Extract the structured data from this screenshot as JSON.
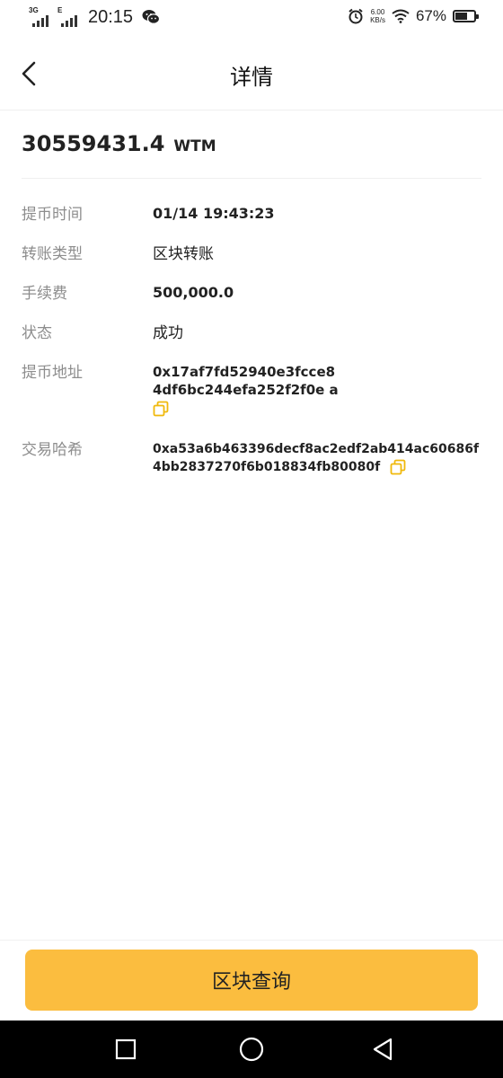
{
  "status_bar": {
    "network1": "3G",
    "network2": "E",
    "time": "20:15",
    "speed_value": "6.00",
    "speed_unit": "KB/s",
    "battery_percent": "67%",
    "battery_level": 0.67
  },
  "header": {
    "title": "详情"
  },
  "amount": {
    "value": "30559431.4",
    "unit": "WTM"
  },
  "details": {
    "time": {
      "label": "提币时间",
      "value": "01/14 19:43:23"
    },
    "type": {
      "label": "转账类型",
      "value": "区块转账"
    },
    "fee": {
      "label": "手续费",
      "value": "500,000.0"
    },
    "status": {
      "label": "状态",
      "value": "成功"
    },
    "address": {
      "label": "提币地址",
      "line1": "0x17af7fd52940e3fcce8",
      "line2": "4df6bc244efa252f2f0e a"
    },
    "hash": {
      "label": "交易哈希",
      "line1": "0xa53a6b463396decf8ac2edf2ab414ac60686f",
      "line2": "4bb2837270f6b018834fb80080f"
    }
  },
  "footer": {
    "button_label": "区块查询"
  },
  "colors": {
    "accent": "#fbbd3f",
    "copy_icon": "#f0b90b",
    "label": "#8d8d8d"
  },
  "icons": [
    "back-arrow-icon",
    "copy-icon",
    "wechat-icon",
    "alarm-icon",
    "wifi-icon",
    "battery-icon",
    "nav-square-icon",
    "nav-circle-icon",
    "nav-triangle-icon"
  ]
}
